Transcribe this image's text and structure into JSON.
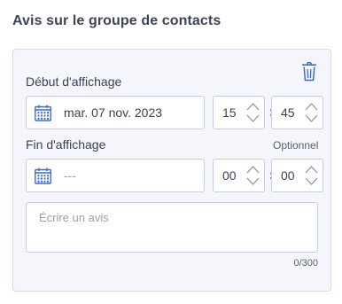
{
  "section_title": "Avis sur le groupe de contacts",
  "start": {
    "label": "Début d'affichage",
    "date_value": "mar. 07 nov. 2023",
    "hour": "15",
    "minute": "45"
  },
  "end": {
    "label": "Fin d'affichage",
    "optional_label": "Optionnel",
    "date_placeholder": "---",
    "hour": "00",
    "minute": "00"
  },
  "time_separator": ":",
  "review": {
    "placeholder": "Écrire un avis",
    "counter": "0/300"
  },
  "colors": {
    "accent": "#3d6cc8",
    "card_bg": "#f4f6fc",
    "border": "#c7cede"
  },
  "icons": {
    "delete": "trash-icon",
    "date": "calendar-icon",
    "stepper": "chevron-up-down-icon"
  }
}
